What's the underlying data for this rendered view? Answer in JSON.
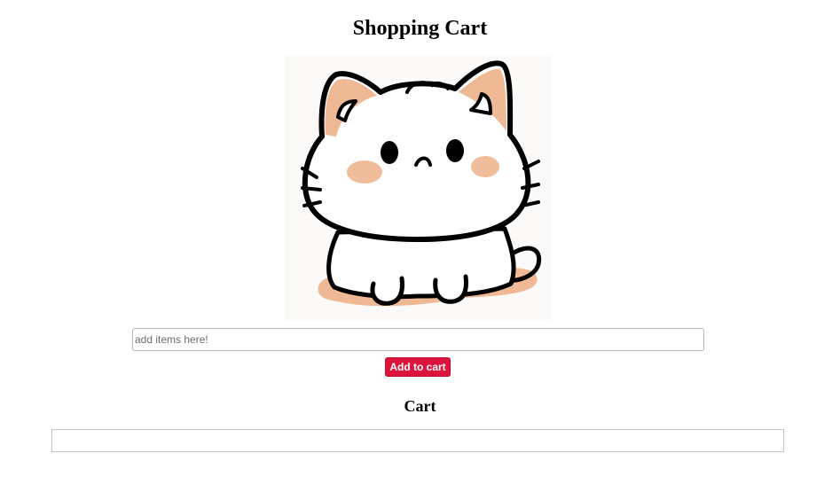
{
  "header": {
    "title": "Shopping Cart"
  },
  "hero": {
    "image_subject": "cute-cat-illustration",
    "colors": {
      "background": "#fcfaf8",
      "outline": "#000000",
      "patch": "#efb995",
      "blush": "#f0bd9b",
      "body": "#ffffff"
    }
  },
  "form": {
    "input_placeholder": "add items here!",
    "input_value": "",
    "add_button_label": "Add to cart",
    "add_button_color": "#dc143c"
  },
  "cart": {
    "heading": "Cart",
    "items": []
  }
}
